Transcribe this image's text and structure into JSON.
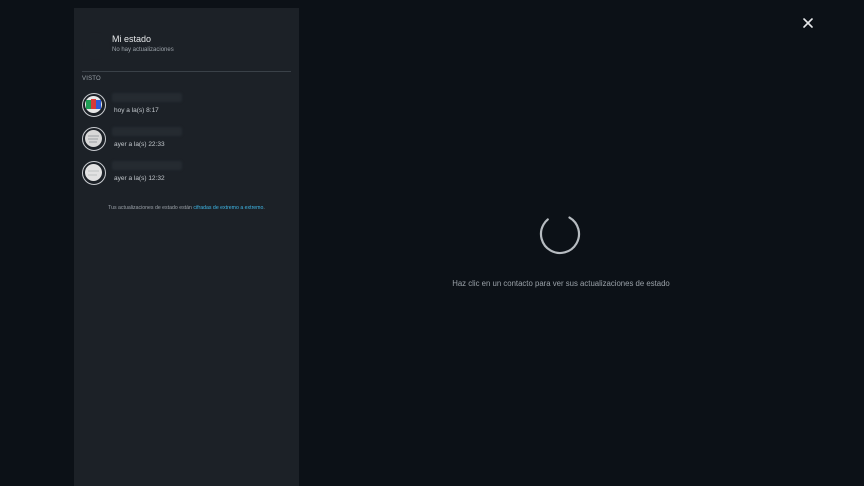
{
  "my_status": {
    "title": "Mi estado",
    "subtitle": "No hay actualizaciones"
  },
  "viewed_section": {
    "label": "VISTO",
    "contacts": [
      {
        "time": "hoy a la(s) 8:17",
        "avatar_colors": [
          "#1f9d55",
          "#d63a3a",
          "#2d5bd8",
          "#e8e8e8"
        ]
      },
      {
        "time": "ayer a la(s) 22:33",
        "avatar_colors": [
          "#d8d8d8"
        ]
      },
      {
        "time": "ayer a la(s) 12:32",
        "avatar_colors": [
          "#e2e2e2"
        ]
      }
    ]
  },
  "encryption_note": {
    "text": "Tus actualizaciones de estado están ",
    "link": "cifradas de extremo a extremo",
    "suffix": "."
  },
  "viewer": {
    "hint": "Haz clic en un contacto para ver sus actualizaciones de estado"
  },
  "colors": {
    "background": "#0c1117",
    "panel": "#1c2127",
    "accent_link": "#3fb8e8"
  },
  "icons": {
    "close": "close-icon",
    "loading": "loading-spinner-icon"
  }
}
